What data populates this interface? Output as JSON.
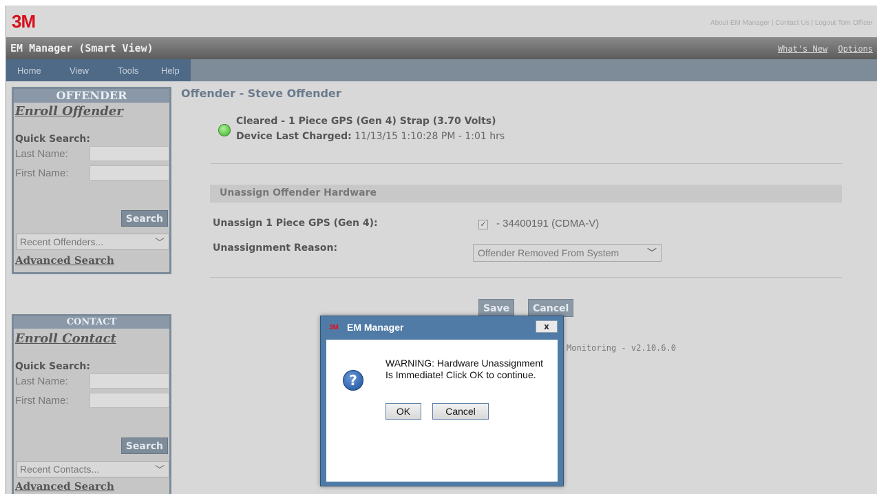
{
  "header": {
    "logo_text": "3M",
    "links": "About EM Manager | Contact Us | Logout Tom Officer"
  },
  "titlebar": {
    "app_title": "EM Manager (Smart View)",
    "whats_new": "What's New",
    "options": "Options"
  },
  "menu": {
    "items": [
      "Home",
      "View",
      "Tools",
      "Help"
    ]
  },
  "offender_panel": {
    "header": "OFFENDER",
    "enroll_link": "Enroll Offender",
    "quick_search": "Quick Search:",
    "last_name_label": "Last Name:",
    "first_name_label": "First Name:",
    "last_name_value": "",
    "first_name_value": "",
    "search_button": "Search",
    "recent_select": "Recent Offenders...",
    "advanced_search": "Advanced Search"
  },
  "contact_panel": {
    "header": "CONTACT",
    "enroll_link": "Enroll Contact",
    "quick_search": "Quick Search:",
    "last_name_label": "Last Name:",
    "first_name_label": "First Name:",
    "last_name_value": "",
    "first_name_value": "",
    "search_button": "Search",
    "recent_select": "Recent Contacts...",
    "advanced_search": "Advanced Search"
  },
  "main": {
    "page_title": "Offender - Steve Offender",
    "status_line1": "Cleared - 1 Piece GPS (Gen 4) Strap (3.70 Volts)",
    "status_line2_label": "Device Last Charged:",
    "status_line2_value": "11/13/15 1:10:28 PM - 1:01 hrs",
    "status_color": "#3db02a",
    "section_title": "Unassign Offender Hardware",
    "unassign_label": "Unassign 1 Piece GPS (Gen 4):",
    "unassign_checked": true,
    "checkbox_mark": "✓",
    "device_text": "- 34400191 (CDMA-V)",
    "reason_label": "Unassignment Reason:",
    "reason_value": "Offender Removed From System",
    "save_button": "Save",
    "cancel_button": "Cancel",
    "version_text": "Monitoring - v2.10.6.0"
  },
  "dialog": {
    "logo_text": "3M",
    "title": "EM Manager",
    "close_label": "x",
    "icon": "question-icon",
    "message": "WARNING: Hardware Unassignment Is Immediate! Click OK to continue.",
    "ok_button": "OK",
    "cancel_button": "Cancel"
  }
}
